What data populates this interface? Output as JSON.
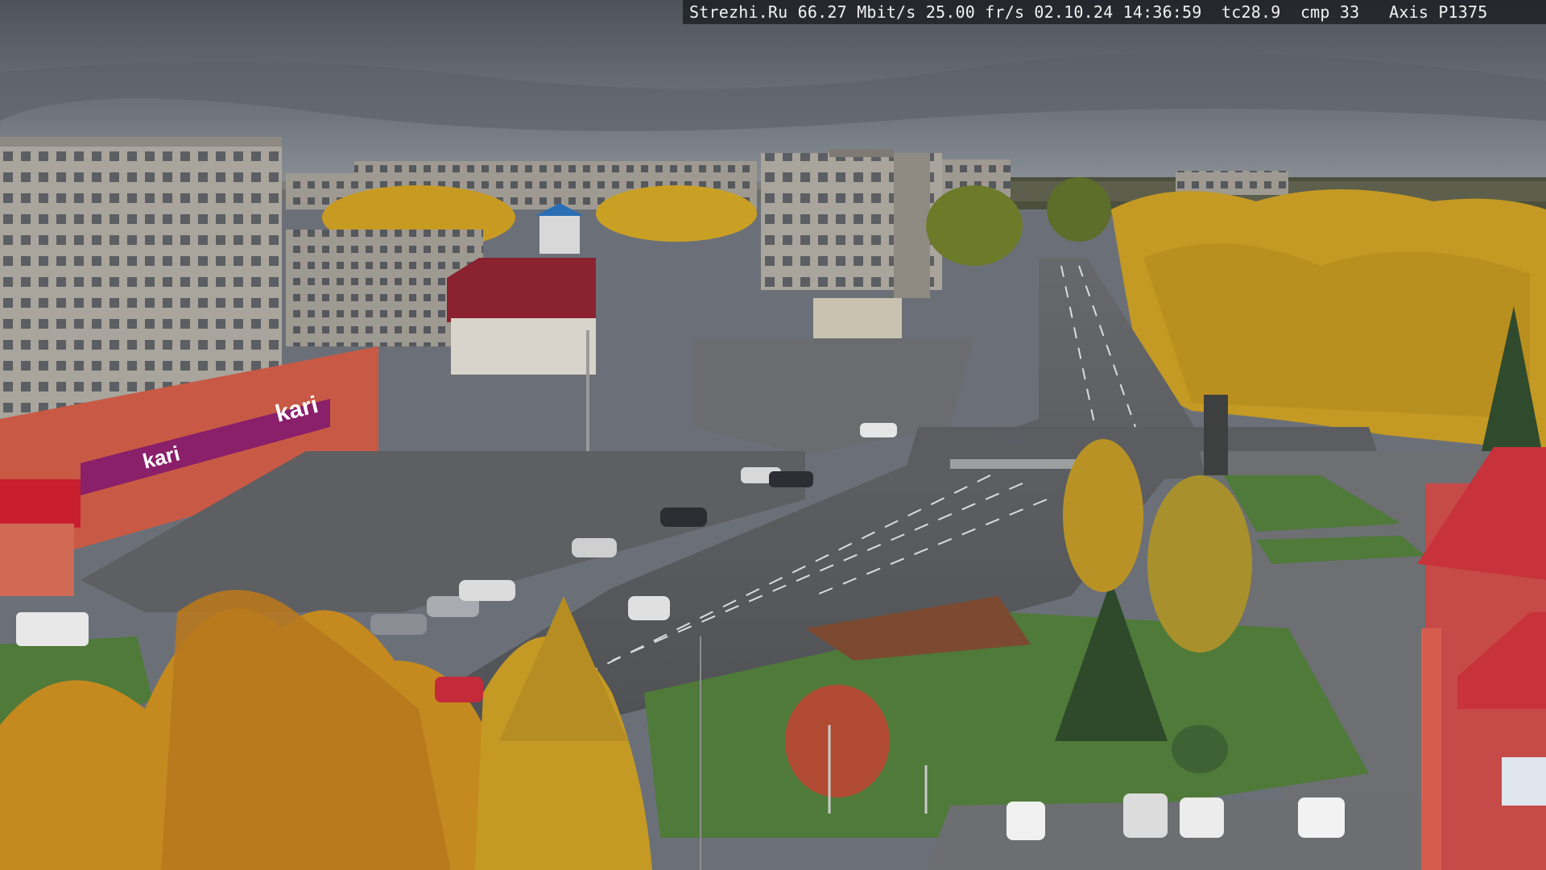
{
  "camera_overlay": {
    "text": "Strezhi.Ru 66.27 Mbit/s 25.00 fr/s 02.10.24 14:36:59  tc28.9  cmp 33   Axis P1375"
  },
  "storefront": {
    "brand_sign": "kari",
    "lower_sign": "kari"
  },
  "colors": {
    "sky": "#5f656e",
    "sky_light": "#8a9098",
    "road": "#545659",
    "grass": "#4f7a3a",
    "autumn_yellow": "#c9a024",
    "autumn_orange": "#b7781e",
    "panel_building": "#a7a39a",
    "store_facade": "#c85a45",
    "store_sign_purple": "#8a1f6a",
    "roof_red": "#c8323a"
  }
}
